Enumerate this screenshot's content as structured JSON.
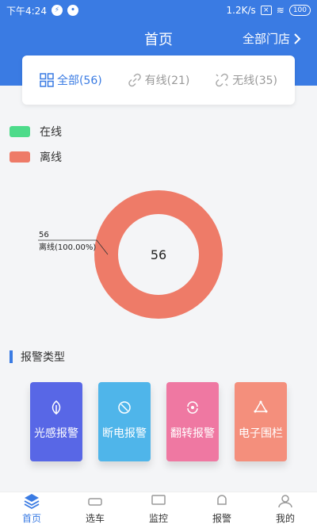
{
  "status_bar": {
    "time": "下午4:24",
    "network_speed": "1.2K/s",
    "battery": "100"
  },
  "header": {
    "title": "首页",
    "all_stores_label": "全部门店"
  },
  "filter_tabs": [
    {
      "label": "全部(56)",
      "active": true
    },
    {
      "label": "有线(21)",
      "active": false
    },
    {
      "label": "无线(35)",
      "active": false
    }
  ],
  "legend": [
    {
      "label": "在线",
      "color": "#4ddb8a"
    },
    {
      "label": "离线",
      "color": "#ee7b68"
    }
  ],
  "chart_data": {
    "type": "pie",
    "center_label": "56",
    "slices": [
      {
        "label": "离线",
        "value": 56,
        "percent_label": "离线(100.00%)",
        "value_label": "56",
        "color": "#ee7b68"
      },
      {
        "label": "在线",
        "value": 0,
        "color": "#4ddb8a"
      }
    ]
  },
  "alarm_section": {
    "title": "报警类型",
    "cards": [
      {
        "label": "光感报警",
        "color": "#5867e6",
        "icon": "leaf-icon"
      },
      {
        "label": "断电报警",
        "color": "#4fb5ea",
        "icon": "power-off-icon"
      },
      {
        "label": "翻转报警",
        "color": "#ef78a2",
        "icon": "rotate-icon"
      },
      {
        "label": "电子围栏",
        "color": "#f48f7c",
        "icon": "fence-icon"
      }
    ]
  },
  "tabbar": [
    {
      "label": "首页",
      "active": true,
      "icon": "layers-icon"
    },
    {
      "label": "选车",
      "active": false,
      "icon": "car-icon"
    },
    {
      "label": "监控",
      "active": false,
      "icon": "monitor-icon"
    },
    {
      "label": "报警",
      "active": false,
      "icon": "bell-icon"
    },
    {
      "label": "我的",
      "active": false,
      "icon": "user-icon"
    }
  ]
}
